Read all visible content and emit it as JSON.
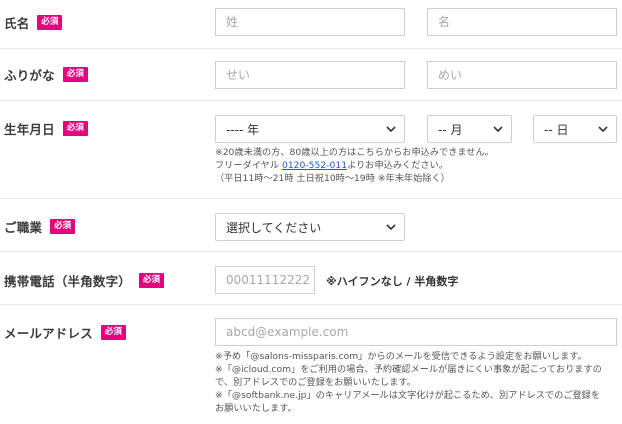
{
  "required_badge": "必須",
  "name": {
    "label": "氏名",
    "last_placeholder": "姓",
    "first_placeholder": "名"
  },
  "kana": {
    "label": "ふりがな",
    "last_placeholder": "せい",
    "first_placeholder": "めい"
  },
  "birthday": {
    "label": "生年月日",
    "year_selected": "---- 年",
    "month_selected": "-- 月",
    "day_selected": "-- 日",
    "note_line1": "※20歳未満の方、80歳以上の方はこちらからお申込みできません。",
    "note_line2_prefix": "フリーダイヤル ",
    "note_phone": "0120-552-011",
    "note_line2_suffix": "よりお申込みください。",
    "note_line3": "（平日11時〜21時 土日祝10時〜19時 ※年末年始除く）"
  },
  "occupation": {
    "label": "ご職業",
    "selected": "選択してください"
  },
  "phone": {
    "label": "携帯電話（半角数字）",
    "placeholder": "00011112222",
    "hint": "※ハイフンなし / 半角数字"
  },
  "email": {
    "label": "メールアドレス",
    "placeholder": "abcd@example.com",
    "note_line1": "※予め「@salons-missparis.com」からのメールを受信できるよう設定をお願いします。",
    "note_line2": "※「@icloud.com」をご利用の場合、予約確認メールが届きにくい事象が起こっておりますの",
    "note_line3": "で、別アドレスでのご登録をお願いいたします。",
    "note_line4": "※「@softbank.ne.jp」のキャリアメールは文字化けが起こるため、別アドレスでのご登録を",
    "note_line5": "お願いいたします。"
  }
}
